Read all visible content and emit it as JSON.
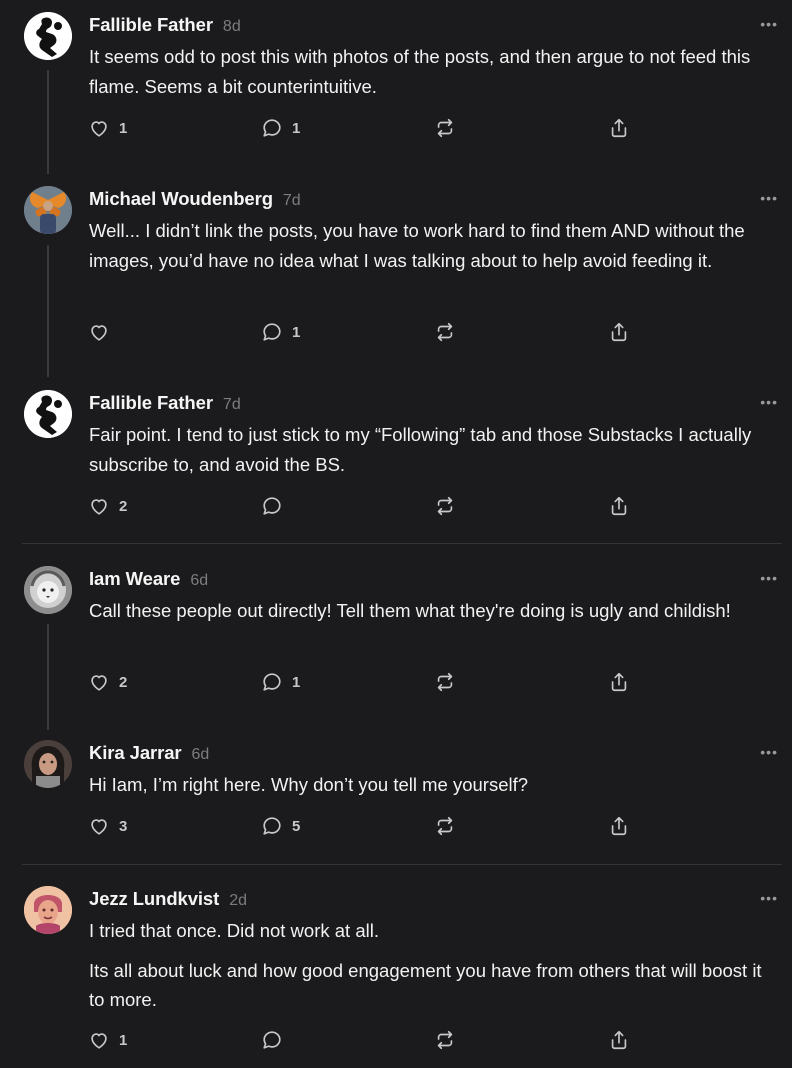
{
  "comments": [
    {
      "author": "Fallible Father",
      "time": "8d",
      "paragraphs": [
        "It seems odd to post this with photos of the posts, and then argue to not feed this flame. Seems a bit counterintuitive."
      ],
      "likes": "1",
      "replies": "1",
      "avatar": "silhouette-avatar"
    },
    {
      "author": "Michael Woudenberg",
      "time": "7d",
      "paragraphs": [
        "Well... I didn’t link the posts, you have to work hard to find them AND without the images, you’d have no idea what I was talking about to help avoid feeding it."
      ],
      "likes": "",
      "replies": "1",
      "avatar": "butterfly-photo-avatar"
    },
    {
      "author": "Fallible Father",
      "time": "7d",
      "paragraphs": [
        "Fair point. I tend to just stick to my “Following” tab and those Substacks I actually subscribe to, and avoid the BS."
      ],
      "likes": "2",
      "replies": "",
      "avatar": "silhouette-avatar"
    },
    {
      "author": "Iam Weare",
      "time": "6d",
      "paragraphs": [
        "Call these people out directly! Tell them what they're doing is ugly and childish!"
      ],
      "likes": "2",
      "replies": "1",
      "avatar": "lion-photo-avatar"
    },
    {
      "author": "Kira Jarrar",
      "time": "6d",
      "paragraphs": [
        "Hi Iam, I’m right here. Why don’t you tell me yourself?"
      ],
      "likes": "3",
      "replies": "5",
      "avatar": "portrait-photo-avatar"
    },
    {
      "author": "Jezz Lundkvist",
      "time": "2d",
      "paragraphs": [
        "I tried that once. Did not work at all.",
        "Its all about luck and how good engagement you have from others that will boost it to more."
      ],
      "likes": "1",
      "replies": "",
      "avatar": "illustrated-avatar"
    }
  ],
  "more_label": "•••",
  "colors": {
    "background": "#1b1b1d",
    "text": "#f2f2f2",
    "muted": "#7d7d80",
    "divider": "#343436"
  }
}
